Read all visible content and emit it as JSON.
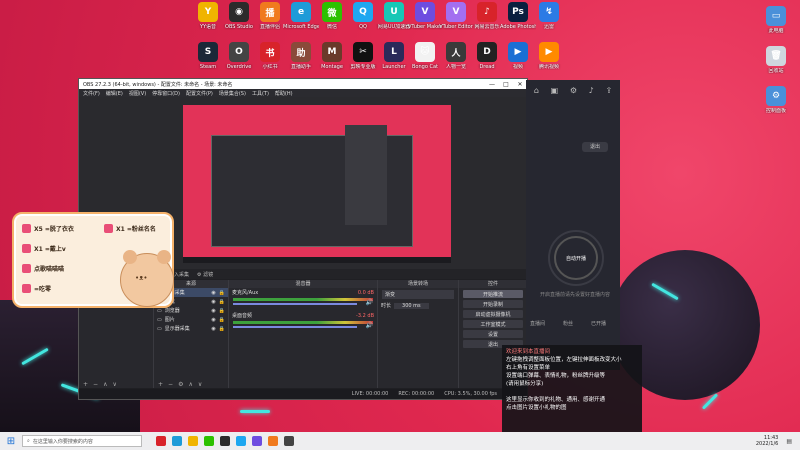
{
  "desktop": {
    "icons_row1": [
      {
        "label": "YY语音",
        "color": "#f0b400",
        "glyph": "Y"
      },
      {
        "label": "OBS Studio",
        "color": "#2b2b2b",
        "glyph": "◉"
      },
      {
        "label": "直播伴侣",
        "color": "#f07a1e",
        "glyph": "播"
      },
      {
        "label": "Microsoft Edge",
        "color": "#1e9bd8",
        "glyph": "e"
      },
      {
        "label": "微信",
        "color": "#2dc100",
        "glyph": "微"
      },
      {
        "label": "QQ",
        "color": "#1ea7f0",
        "glyph": "Q"
      },
      {
        "label": "网易UU加速器",
        "color": "#18c7b6",
        "glyph": "U"
      },
      {
        "label": "VTuber Maker",
        "color": "#6e4de0",
        "glyph": "V"
      },
      {
        "label": "VTuber Editor",
        "color": "#a36ff0",
        "glyph": "V"
      },
      {
        "label": "网易云音乐",
        "color": "#d8232a",
        "glyph": "♪"
      },
      {
        "label": "Adobe Photoshop",
        "color": "#0a1f3f",
        "glyph": "Ps"
      },
      {
        "label": "迅雷",
        "color": "#2c7be5",
        "glyph": "↯"
      }
    ],
    "icons_row2": [
      {
        "label": "Steam",
        "color": "#1b2838",
        "glyph": "S"
      },
      {
        "label": "Overdrive",
        "color": "#444",
        "glyph": "O"
      },
      {
        "label": "小红书",
        "color": "#d8232a",
        "glyph": "书"
      },
      {
        "label": "直播助手",
        "color": "#8a4a3a",
        "glyph": "助"
      },
      {
        "label": "Montage",
        "color": "#6a3a2a",
        "glyph": "M"
      },
      {
        "label": "剪映专业版",
        "color": "#111",
        "glyph": "✂"
      },
      {
        "label": "Launcher",
        "color": "#2a2a5a",
        "glyph": "L"
      },
      {
        "label": "Bongo Cat",
        "color": "#f2f2f2",
        "glyph": "🐱"
      },
      {
        "label": "人物一览",
        "color": "#3a3a3a",
        "glyph": "人"
      },
      {
        "label": "Dread",
        "color": "#222",
        "glyph": "D"
      },
      {
        "label": "视频",
        "color": "#1a6fd4",
        "glyph": "▶"
      },
      {
        "label": "腾讯视频",
        "color": "#ff8a00",
        "glyph": "▶"
      }
    ],
    "right_icons": [
      {
        "label": "此电脑",
        "color": "#4a90d9",
        "glyph": "▭"
      },
      {
        "label": "回收站",
        "color": "#cfd6de",
        "glyph": "🗑"
      },
      {
        "label": "控制面板",
        "color": "#4a90d9",
        "glyph": "⚙"
      }
    ]
  },
  "obs": {
    "title": "OBS 27.2.3 (64-bit, windows) - 配置文件: 未命名 - 场景: 未命名",
    "menu": [
      "文件(F)",
      "编辑(E)",
      "视图(V)",
      "停靠窗口(D)",
      "配置文件(P)",
      "场景集合(S)",
      "工具(T)",
      "帮助(H)"
    ],
    "status_items": [
      "音频输入采集",
      "⚙ 滤镜"
    ],
    "docks": {
      "scenes": {
        "header": "场景",
        "items": [
          "场景"
        ]
      },
      "sources": {
        "header": "来源",
        "items": [
          "窗口采集",
          "游戏",
          "浏览器",
          "图片",
          "显示器采集"
        ]
      },
      "mixer": {
        "header": "混音器",
        "channels": [
          {
            "name": "麦克风/Aux",
            "level": "0.0 dB"
          },
          {
            "name": "桌面音频",
            "level": "-3.2 dB"
          }
        ]
      },
      "transitions": {
        "header": "场景转场",
        "type": "渐变",
        "duration_label": "时长",
        "duration_value": "300 ms"
      },
      "controls": {
        "header": "控件",
        "buttons": [
          "开始推流",
          "开始录制",
          "启动虚拟摄像机",
          "工作室模式",
          "设置",
          "退出"
        ]
      }
    },
    "bottom": {
      "live": "LIVE: 00:00:00",
      "rec": "REC: 00:00:00",
      "cpu": "CPU: 3.5%, 30.00 fps"
    }
  },
  "assistant": {
    "exit_label": "退出",
    "start_label": "自动开播",
    "tip": "开启直播前请先设置好直播内容",
    "stats": [
      "直播间",
      "粉丝",
      "已开播"
    ]
  },
  "chat": {
    "lines": [
      {
        "text": "欢迎来到本直播间",
        "highlight": true
      },
      {
        "text": "左键拖拽调整面板位置，左键拉伸面板改变大小",
        "highlight": false
      },
      {
        "text": "右上角有设置菜单",
        "highlight": false
      },
      {
        "text": "设置端口弹幕、表情礼物，粉丝牌升级等",
        "highlight": false
      },
      {
        "text": "(请用鼠标分享)",
        "highlight": false
      },
      {
        "text": "",
        "highlight": false
      },
      {
        "text": "这里显示你收到的礼物、通用、感谢开通",
        "highlight": false
      },
      {
        "text": "点击图片设置小礼物的图",
        "highlight": false
      }
    ]
  },
  "sticker": {
    "items": [
      {
        "key": "X5",
        "label": "X5 =脱了衣衣"
      },
      {
        "key": "X1",
        "label": "X1 =粉丝名名"
      },
      {
        "key": "X1",
        "label": "X1 =戴上v"
      },
      {
        "key": "笑",
        "label": "点歌喵喵喵"
      },
      {
        "key": "吃",
        "label": "=吃零"
      }
    ]
  },
  "taskbar": {
    "search_placeholder": "在这里输入你要搜索的内容",
    "time": "11:43",
    "date": "2022/1/6"
  }
}
